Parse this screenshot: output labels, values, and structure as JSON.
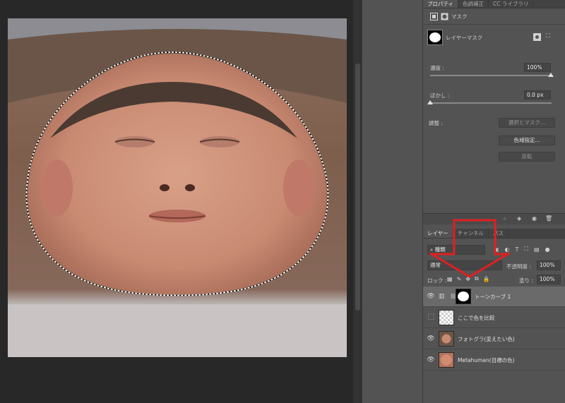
{
  "properties_panel": {
    "tabs": [
      "プロパティ",
      "色調補正",
      "CC ライブラリ"
    ],
    "mask_header": "マスク",
    "layer_mask_label": "レイヤーマスク",
    "density_label": "濃度 :",
    "density_value": "100%",
    "feather_label": "ぼかし :",
    "feather_value": "0.0 px",
    "adjust_label": "調整 :",
    "select_mask_button": "選択とマスク...",
    "color_range_button": "色域指定...",
    "invert_button": "反転"
  },
  "layers_panel": {
    "tabs": [
      "レイヤー",
      "チャンネル",
      "パス"
    ],
    "filter_kind": "種類",
    "blend_mode": "通常",
    "opacity_label": "不透明度 :",
    "opacity_value": "100%",
    "lock_label": "ロック :",
    "fill_label": "塗り :",
    "fill_value": "100%",
    "layers": [
      {
        "name": "トーンカーブ 1",
        "visible": true,
        "selected": true
      },
      {
        "name": "ここで色を比較",
        "visible": false,
        "selected": false
      },
      {
        "name": "フォトグラ(変えたい色)",
        "visible": true,
        "selected": false
      },
      {
        "name": "Metahuman(目標の色)",
        "visible": true,
        "selected": false
      }
    ]
  },
  "annotation": {
    "arrow_color": "#e02020"
  }
}
